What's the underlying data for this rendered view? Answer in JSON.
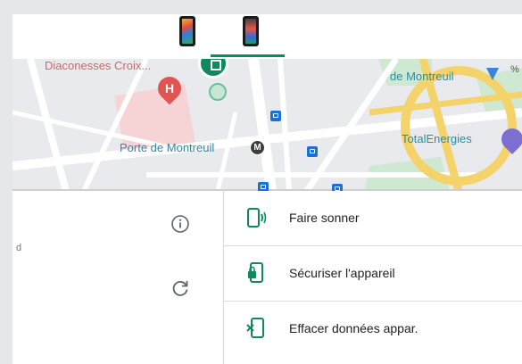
{
  "top_bar": {
    "devices": [
      {
        "icon": "phone-icon-colorful"
      },
      {
        "icon": "phone-icon-dark"
      }
    ],
    "accent_color": "#0f8a5f"
  },
  "map": {
    "labels": {
      "diaconesses": "Diaconesses Croix...",
      "porte_de_montreuil": "Porte de Montreuil",
      "de_montreuil": "de Montreuil",
      "total_energies": "TotalEnergies",
      "partial_right": "%"
    },
    "metro_badge": "M",
    "hospital_badge": "H"
  },
  "left_panel": {
    "partial_text": "d"
  },
  "actions": [
    {
      "label": "Faire sonner",
      "icon": "ring-device-icon"
    },
    {
      "label": "Sécuriser l'appareil",
      "icon": "secure-device-icon"
    },
    {
      "label": "Effacer données appar.",
      "icon": "erase-device-icon"
    }
  ],
  "colors": {
    "accent": "#0f8a5f",
    "map_road": "#ffffff",
    "map_highway": "#f3d36a",
    "map_label": "#2a8ca2"
  }
}
